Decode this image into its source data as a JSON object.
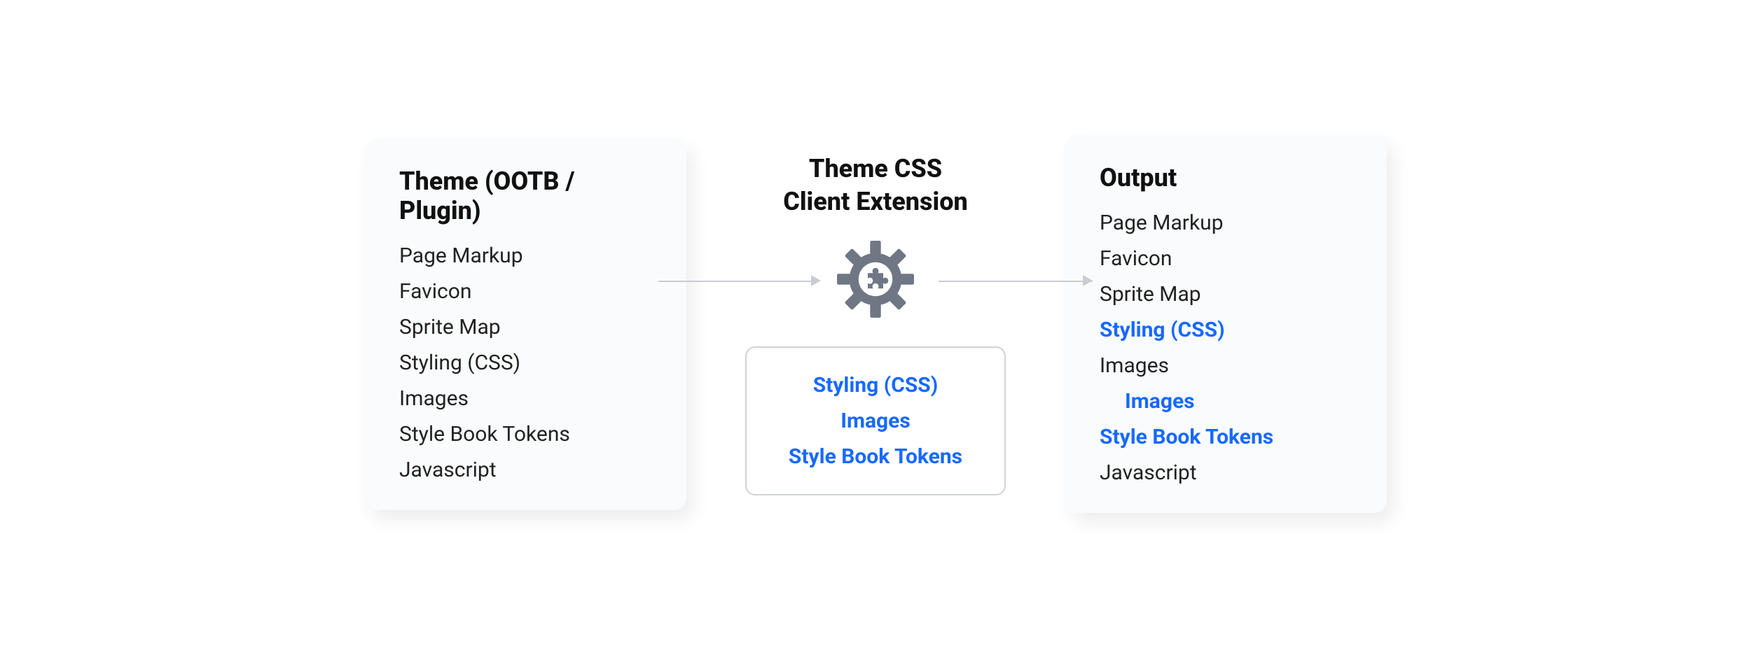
{
  "left": {
    "title": "Theme (OOTB / Plugin)",
    "items": [
      "Page Markup",
      "Favicon",
      "Sprite Map",
      "Styling (CSS)",
      "Images",
      "Style Book Tokens",
      "Javascript"
    ]
  },
  "center": {
    "title_line1": "Theme CSS",
    "title_line2": "Client Extension",
    "box_items": [
      "Styling (CSS)",
      "Images",
      "Style Book Tokens"
    ]
  },
  "right": {
    "title": "Output",
    "items": [
      {
        "label": "Page Markup",
        "hl": false,
        "indent": false
      },
      {
        "label": "Favicon",
        "hl": false,
        "indent": false
      },
      {
        "label": "Sprite Map",
        "hl": false,
        "indent": false
      },
      {
        "label": "Styling (CSS)",
        "hl": true,
        "indent": false
      },
      {
        "label": "Images",
        "hl": false,
        "indent": false
      },
      {
        "label": "Images",
        "hl": true,
        "indent": true
      },
      {
        "label": "Style Book Tokens",
        "hl": true,
        "indent": false
      },
      {
        "label": "Javascript",
        "hl": false,
        "indent": false
      }
    ]
  },
  "colors": {
    "highlight": "#1769ff",
    "panel_bg": "#fafbfc",
    "gear": "#6f7785"
  }
}
